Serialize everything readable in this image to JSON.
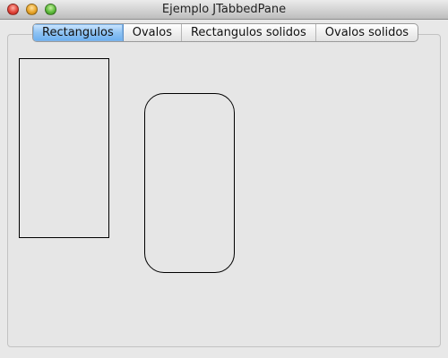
{
  "window": {
    "title": "Ejemplo JTabbedPane"
  },
  "tabs": [
    {
      "label": "Rectangulos",
      "selected": true
    },
    {
      "label": "Ovalos",
      "selected": false
    },
    {
      "label": "Rectangulos solidos",
      "selected": false
    },
    {
      "label": "Ovalos solidos",
      "selected": false
    }
  ],
  "colors": {
    "selected_tab": "#8fc3f3",
    "panel_background": "#e6e6e6",
    "shape_stroke": "#000000"
  },
  "canvas": {
    "shapes": [
      {
        "kind": "rectangle"
      },
      {
        "kind": "rounded-rectangle"
      }
    ]
  }
}
